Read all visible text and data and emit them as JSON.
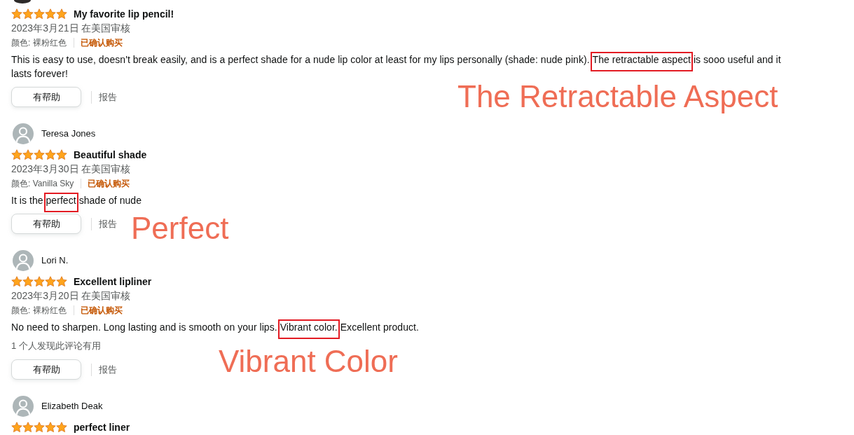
{
  "reviews": [
    {
      "avatar": {
        "kind": "photo"
      },
      "stars": 5,
      "title": "My favorite lip pencil!",
      "date": "2023年3月21日 在美国审核",
      "variant": "颜色: 裸粉红色",
      "verified": "已确认购买",
      "body": {
        "before": "This is easy to use, doesn't break easily, and is a perfect shade for a nude lip color at least for my lips personally (shade: nude pink). ",
        "highlighted": "The retractable aspect",
        "after": " is sooo useful and it lasts forever!"
      },
      "helpful_button": "有帮助",
      "report_link": "报告",
      "annotation": "The Retractable Aspect"
    },
    {
      "avatar": {
        "kind": "default"
      },
      "name": "Teresa Jones",
      "stars": 5,
      "title": "Beautiful shade",
      "date": "2023年3月30日 在美国审核",
      "variant": "颜色: Vanilla Sky",
      "verified": "已确认购买",
      "body": {
        "before": "It is the ",
        "highlighted": "perfect",
        "after": " shade of nude"
      },
      "helpful_button": "有帮助",
      "report_link": "报告",
      "annotation": "Perfect"
    },
    {
      "avatar": {
        "kind": "default"
      },
      "name": "Lori N.",
      "stars": 5,
      "title": "Excellent lipliner",
      "date": "2023年3月20日 在美国审核",
      "variant": "颜色: 裸粉红色",
      "verified": "已确认购买",
      "body": {
        "before": "No need to sharpen. Long lasting and is smooth on your lips. ",
        "highlighted": "Vibrant color.",
        "after": " Excellent product."
      },
      "helpful_count": "1 个人发现此评论有用",
      "helpful_button": "有帮助",
      "report_link": "报告",
      "annotation": "Vibrant Color"
    },
    {
      "avatar": {
        "kind": "default"
      },
      "name": "Elizabeth Deak",
      "stars": 5,
      "title": "perfect liner"
    }
  ]
}
